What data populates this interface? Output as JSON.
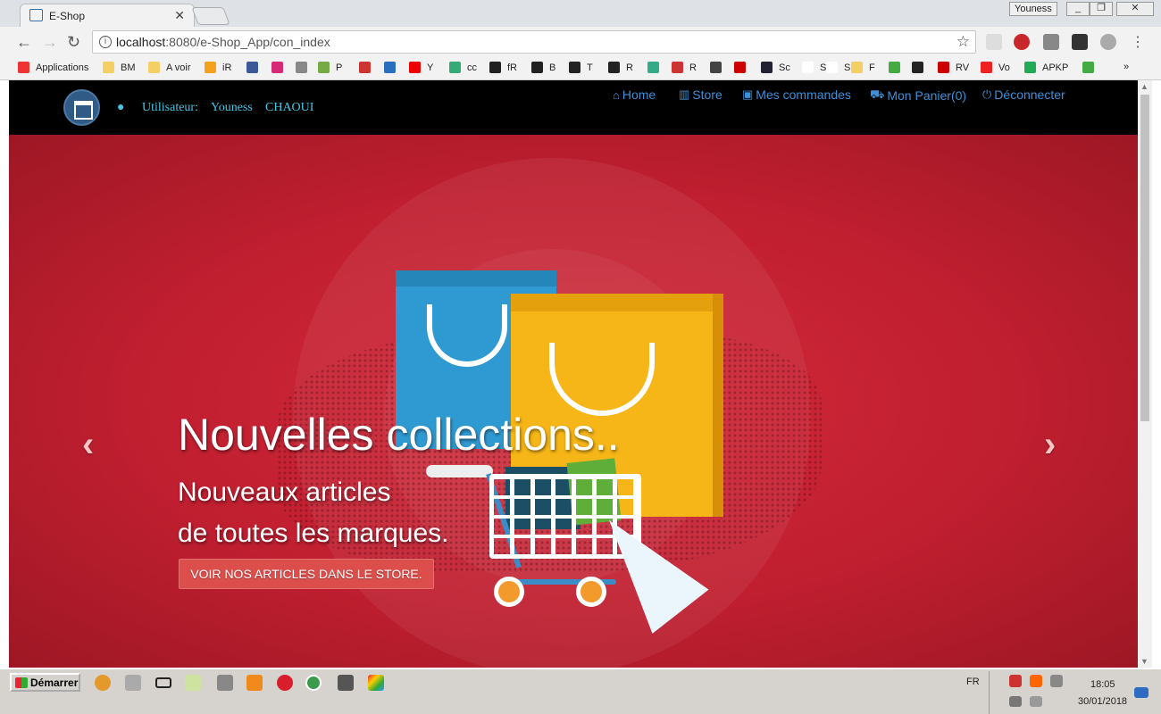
{
  "browser": {
    "tab_title": "E-Shop",
    "tab_close": "✕",
    "window_user": "Youness",
    "url_host": "localhost",
    "url_path": ":8080/e-Shop_App/con_index",
    "bookmarks": [
      "Applications",
      "BM",
      "A voir",
      "iR",
      "",
      "",
      "",
      "P",
      "",
      "",
      "Y",
      "cc",
      "fR",
      "B",
      "T",
      "R",
      "",
      "R",
      "",
      "",
      "Sc",
      "SM",
      "Sm",
      "F",
      "",
      "",
      "RV",
      "Vo",
      "APKP",
      ""
    ],
    "bookmarks_more": "»"
  },
  "site": {
    "user_label": "Utilisateur:",
    "user_first": "Youness",
    "user_last": "CHAOUI",
    "nav": [
      {
        "label": "Home",
        "icon": "home-icon"
      },
      {
        "label": "Store",
        "icon": "barcode-icon"
      },
      {
        "label": "Mes commandes",
        "icon": "gift-icon"
      },
      {
        "label": "Mon Panier(0)",
        "icon": "cart-icon"
      },
      {
        "label": "Déconnecter",
        "icon": "power-icon"
      }
    ]
  },
  "hero": {
    "headline": "Nouvelles collections..",
    "sub_line1": "Nouveaux articles",
    "sub_line2": "de toutes les marques.",
    "cta": "VOIR NOS ARTICLES DANS LE STORE.",
    "prev": "‹",
    "next": "›"
  },
  "taskbar": {
    "start_label": "Démarrer",
    "lang": "FR",
    "time": "18:05",
    "date": "30/01/2018"
  },
  "colors": {
    "navbar_bg": "#000000",
    "nav_link": "#3d8fd8",
    "user_text": "#46c6e6",
    "hero_red": "#c01f30",
    "cta_bg": "#db4e4b"
  }
}
